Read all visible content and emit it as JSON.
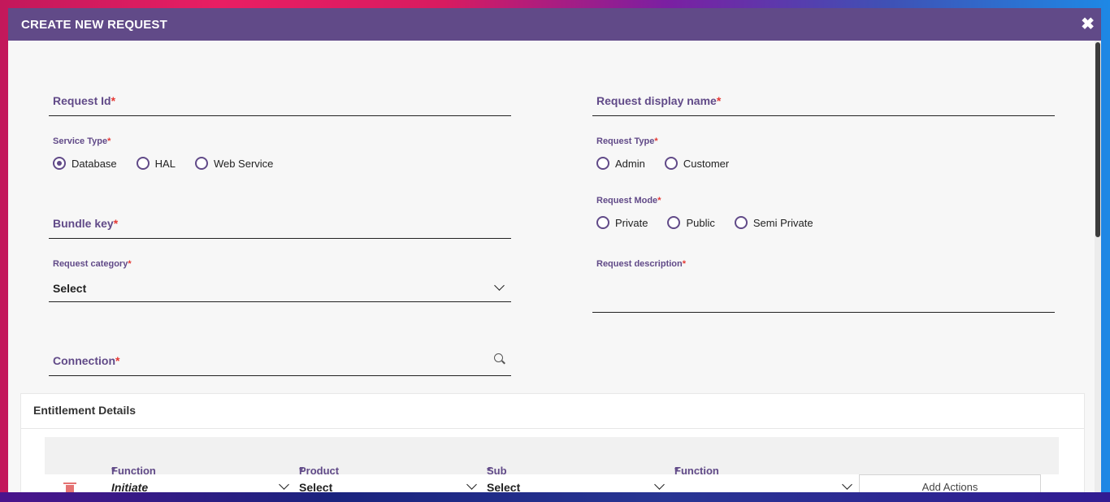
{
  "modal": {
    "title": "CREATE NEW REQUEST"
  },
  "request_id": {
    "label": "Request Id",
    "required": "*"
  },
  "display_name": {
    "label": "Request display name",
    "required": "*"
  },
  "service_type": {
    "label": "Service Type",
    "required": "*",
    "options": [
      "Database",
      "HAL",
      "Web Service"
    ],
    "selected": "Database"
  },
  "request_type": {
    "label": "Request Type",
    "required": "*",
    "options": [
      "Admin",
      "Customer"
    ],
    "selected": ""
  },
  "request_mode": {
    "label": "Request Mode",
    "required": "*",
    "options": [
      "Private",
      "Public",
      "Semi Private"
    ],
    "selected": ""
  },
  "bundle_key": {
    "label": "Bundle key",
    "required": "*"
  },
  "request_category": {
    "label": "Request category",
    "required": "*",
    "value": "Select"
  },
  "request_description": {
    "label": "Request description",
    "required": "*"
  },
  "connection": {
    "label": "Connection",
    "required": "*"
  },
  "entitlement": {
    "title": "Entitlement Details",
    "columns": [
      {
        "label": "Function Category",
        "required": "*"
      },
      {
        "label": "Product",
        "required": "*"
      },
      {
        "label": "Sub Product",
        "required": "*"
      },
      {
        "label": "Function",
        "required": "*"
      }
    ],
    "row": {
      "function_category": "Initiate",
      "product": "Select",
      "sub_product": "Select",
      "function": "",
      "add_actions": "Add Actions"
    }
  },
  "icons": {
    "close": "close-icon",
    "search": "search-icon",
    "chevron": "chevron-down-icon",
    "delete": "trash-icon"
  },
  "colors": {
    "accent": "#614a88",
    "required": "#e53935",
    "delete": "#e57373"
  }
}
